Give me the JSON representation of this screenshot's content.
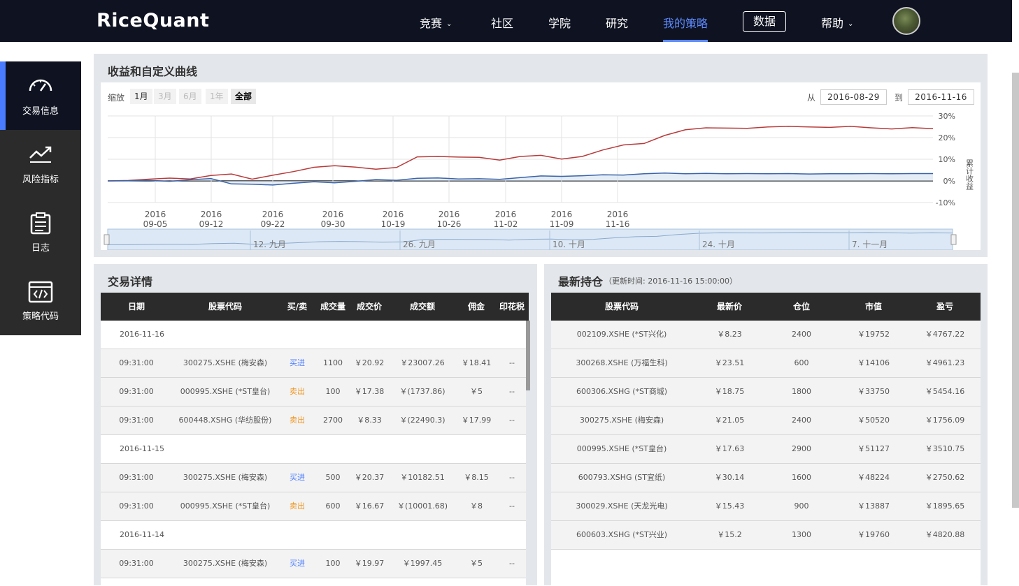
{
  "header": {
    "logo": "RiceQuant",
    "nav": [
      {
        "label": "竞赛",
        "dropdown": true
      },
      {
        "label": "社区"
      },
      {
        "label": "学院"
      },
      {
        "label": "研究"
      },
      {
        "label": "我的策略",
        "active": true
      },
      {
        "label": "数据",
        "boxed": true
      },
      {
        "label": "帮助",
        "dropdown": true
      }
    ]
  },
  "sidebar": {
    "items": [
      {
        "label": "交易信息",
        "icon": "gauge-icon",
        "active": true
      },
      {
        "label": "风险指标",
        "icon": "trend-icon"
      },
      {
        "label": "日志",
        "icon": "clipboard-icon"
      },
      {
        "label": "策略代码",
        "icon": "code-icon"
      }
    ]
  },
  "chart_panel": {
    "title": "收益和自定义曲线",
    "zoom_label": "缩放",
    "zoom_options": [
      "1月",
      "3月",
      "6月",
      "1年",
      "全部"
    ],
    "zoom_selected": "全部",
    "from_label": "从",
    "from_date": "2016-08-29",
    "to_label": "到",
    "to_date": "2016-11-16",
    "y_axis_title": "累计收益",
    "navigator_labels": [
      "12. 九月",
      "26. 九月",
      "10. 十月",
      "24. 十月",
      "7. 十一月"
    ]
  },
  "chart_data": {
    "type": "line",
    "x_ticks": [
      [
        "2016",
        "09-05"
      ],
      [
        "2016",
        "09-12"
      ],
      [
        "2016",
        "09-22"
      ],
      [
        "2016",
        "09-30"
      ],
      [
        "2016",
        "10-19"
      ],
      [
        "2016",
        "10-26"
      ],
      [
        "2016",
        "11-02"
      ],
      [
        "2016",
        "11-09"
      ],
      [
        "2016",
        "11-16"
      ]
    ],
    "y_ticks": [
      "30%",
      "20%",
      "10%",
      "0%",
      "-10%"
    ],
    "ylim": [
      -10,
      30
    ],
    "series": [
      {
        "color": "#b83a3a",
        "values": [
          0,
          0.2,
          0.8,
          1.3,
          0.9,
          2.5,
          3.2,
          0.8,
          2.6,
          4.3,
          6.3,
          7.0,
          6.4,
          5.4,
          6.2,
          11.1,
          11.3,
          11.0,
          10.9,
          9.6,
          11.3,
          11.8,
          10.1,
          11.3,
          14.3,
          16.6,
          17.3,
          21.0,
          23.6,
          24.5,
          24.4,
          24.3,
          24.9,
          25.2,
          24.9,
          24.7,
          25.2,
          24.5,
          24.0,
          24.6,
          24.1
        ]
      },
      {
        "color": "#3a63a8",
        "values": [
          0,
          0.1,
          0.3,
          -0.2,
          0.5,
          1.1,
          -1.4,
          -1.5,
          -1.9,
          -1.1,
          -0.4,
          -0.9,
          -0.2,
          0.6,
          0.3,
          1.2,
          1.4,
          0.9,
          1.0,
          0.7,
          1.5,
          2.3,
          2.1,
          2.4,
          2.8,
          2.7,
          3.3,
          3.6,
          3.3,
          3.5,
          3.3,
          3.4,
          3.3,
          3.4,
          3.2,
          3.3,
          3.3,
          3.4,
          3.3,
          3.4,
          3.4
        ]
      }
    ]
  },
  "trades_panel": {
    "title": "交易详情",
    "columns": [
      "日期",
      "股票代码",
      "买/卖",
      "成交量",
      "成交价",
      "成交额",
      "佣金",
      "印花税"
    ],
    "rows": [
      {
        "date_header": "2016-11-16"
      },
      {
        "time": "09:31:00",
        "code": "300275.XSHE (梅安森)",
        "side": "买进",
        "side_type": "buy",
        "qty": "1100",
        "price": "￥20.92",
        "amount": "￥23007.26",
        "fee": "￥18.41",
        "tax": "--"
      },
      {
        "time": "09:31:00",
        "code": "000995.XSHE (*ST皇台)",
        "side": "卖出",
        "side_type": "sell",
        "qty": "100",
        "price": "￥17.38",
        "amount": "￥(1737.86)",
        "fee": "￥5",
        "tax": "--"
      },
      {
        "time": "09:31:00",
        "code": "600448.XSHG (华纺股份)",
        "side": "卖出",
        "side_type": "sell",
        "qty": "2700",
        "price": "￥8.33",
        "amount": "￥(22490.3)",
        "fee": "￥17.99",
        "tax": "--"
      },
      {
        "date_header": "2016-11-15"
      },
      {
        "time": "09:31:00",
        "code": "300275.XSHE (梅安森)",
        "side": "买进",
        "side_type": "buy",
        "qty": "500",
        "price": "￥20.37",
        "amount": "￥10182.51",
        "fee": "￥8.15",
        "tax": "--"
      },
      {
        "time": "09:31:00",
        "code": "000995.XSHE (*ST皇台)",
        "side": "卖出",
        "side_type": "sell",
        "qty": "600",
        "price": "￥16.67",
        "amount": "￥(10001.68)",
        "fee": "￥8",
        "tax": "--"
      },
      {
        "date_header": "2016-11-14"
      },
      {
        "time": "09:31:00",
        "code": "300275.XSHE (梅安森)",
        "side": "买进",
        "side_type": "buy",
        "qty": "100",
        "price": "￥19.97",
        "amount": "￥1997.45",
        "fee": "￥5",
        "tax": "--"
      }
    ]
  },
  "positions_panel": {
    "title": "最新持仓",
    "subtitle": "（更新时间: 2016-11-16  15:00:00）",
    "columns": [
      "股票代码",
      "最新价",
      "仓位",
      "市值",
      "盈亏"
    ],
    "rows": [
      {
        "code": "002109.XSHE (*ST兴化)",
        "price": "￥8.23",
        "qty": "2400",
        "value": "￥19752",
        "pnl": "￥4767.22"
      },
      {
        "code": "300268.XSHE (万福生科)",
        "price": "￥23.51",
        "qty": "600",
        "value": "￥14106",
        "pnl": "￥4961.23"
      },
      {
        "code": "600306.XSHG (*ST商城)",
        "price": "￥18.75",
        "qty": "1800",
        "value": "￥33750",
        "pnl": "￥5454.16"
      },
      {
        "code": "300275.XSHE (梅安森)",
        "price": "￥21.05",
        "qty": "2400",
        "value": "￥50520",
        "pnl": "￥1756.09"
      },
      {
        "code": "000995.XSHE (*ST皇台)",
        "price": "￥17.63",
        "qty": "2900",
        "value": "￥51127",
        "pnl": "￥3510.75"
      },
      {
        "code": "600793.XSHG (ST宜纸)",
        "price": "￥30.14",
        "qty": "1600",
        "value": "￥48224",
        "pnl": "￥2750.62"
      },
      {
        "code": "300029.XSHE (天龙光电)",
        "price": "￥15.43",
        "qty": "900",
        "value": "￥13887",
        "pnl": "￥1895.65"
      },
      {
        "code": "600603.XSHG (*ST兴业)",
        "price": "￥15.2",
        "qty": "1300",
        "value": "￥19760",
        "pnl": "￥4820.88"
      }
    ]
  }
}
